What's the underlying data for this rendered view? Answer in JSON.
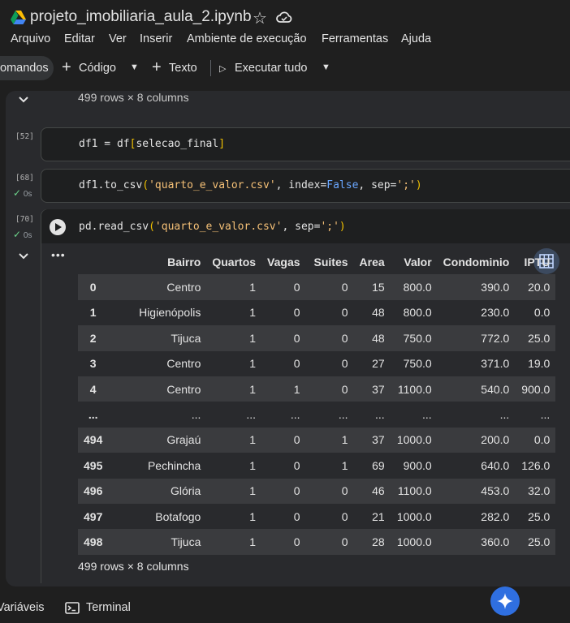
{
  "header": {
    "title": "projeto_imobiliaria_aula_2.ipynb"
  },
  "menu": [
    "Arquivo",
    "Editar",
    "Ver",
    "Inserir",
    "Ambiente de execução",
    "Ferramentas",
    "Ajuda"
  ],
  "toolbar": {
    "commands_label": "omandos",
    "code_label": "Código",
    "text_label": "Texto",
    "run_all_label": "Executar tudo"
  },
  "previous_output": {
    "shape": "499 rows × 8 columns"
  },
  "cells": [
    {
      "exec": "[52]",
      "status": "",
      "code": {
        "a": "df1 = df",
        "b": "[",
        "c": "selecao_final",
        "d": "]"
      }
    },
    {
      "exec": "[68]",
      "status": "0s",
      "code": {
        "a": "df1.to_csv",
        "b": "(",
        "s": "'quarto_e_valor.csv'",
        "c": ", index=",
        "k": "False",
        "e": ", sep=",
        "s2": "';'",
        "d": ")"
      }
    },
    {
      "exec": "[70]",
      "status": "0s",
      "code": {
        "a": "pd.read_csv",
        "b": "(",
        "s": "'quarto_e_valor.csv'",
        "e": ", sep=",
        "s2": "';'",
        "d": ")"
      }
    }
  ],
  "output": {
    "menu_glyph": "•••",
    "columns": [
      "",
      "Bairro",
      "Quartos",
      "Vagas",
      "Suites",
      "Area",
      "Valor",
      "Condominio",
      "IPTU"
    ],
    "rows": [
      [
        "0",
        "Centro",
        "1",
        "0",
        "0",
        "15",
        "800.0",
        "390.0",
        "20.0"
      ],
      [
        "1",
        "Higienópolis",
        "1",
        "0",
        "0",
        "48",
        "800.0",
        "230.0",
        "0.0"
      ],
      [
        "2",
        "Tijuca",
        "1",
        "0",
        "0",
        "48",
        "750.0",
        "772.0",
        "25.0"
      ],
      [
        "3",
        "Centro",
        "1",
        "0",
        "0",
        "27",
        "750.0",
        "371.0",
        "19.0"
      ],
      [
        "4",
        "Centro",
        "1",
        "1",
        "0",
        "37",
        "1100.0",
        "540.0",
        "900.0"
      ],
      [
        "...",
        "...",
        "...",
        "...",
        "...",
        "...",
        "...",
        "...",
        "..."
      ],
      [
        "494",
        "Grajaú",
        "1",
        "0",
        "1",
        "37",
        "1000.0",
        "200.0",
        "0.0"
      ],
      [
        "495",
        "Pechincha",
        "1",
        "0",
        "1",
        "69",
        "900.0",
        "640.0",
        "126.0"
      ],
      [
        "496",
        "Glória",
        "1",
        "0",
        "0",
        "46",
        "1100.0",
        "453.0",
        "32.0"
      ],
      [
        "497",
        "Botafogo",
        "1",
        "0",
        "0",
        "21",
        "1000.0",
        "282.0",
        "25.0"
      ],
      [
        "498",
        "Tijuca",
        "1",
        "0",
        "0",
        "28",
        "1000.0",
        "360.0",
        "25.0"
      ]
    ],
    "shape": "499 rows × 8 columns"
  },
  "bottombar": {
    "variables_label": "Variáveis",
    "terminal_label": "Terminal"
  }
}
